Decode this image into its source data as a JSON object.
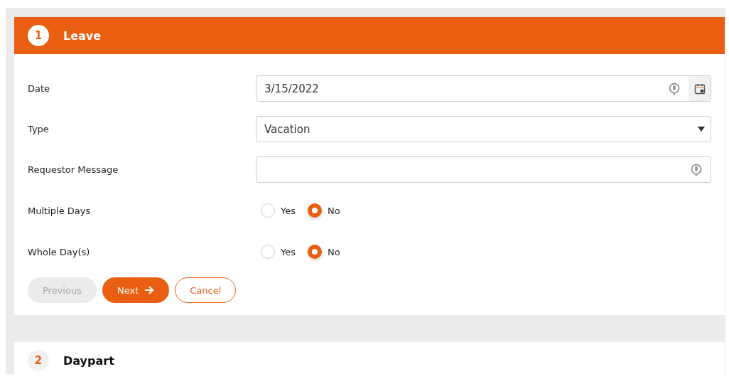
{
  "steps": [
    {
      "number": "1",
      "title": "Leave",
      "active": true,
      "fields": [
        {
          "kind": "date",
          "label": "Date",
          "value": "3/15/2022"
        },
        {
          "kind": "select",
          "label": "Type",
          "value": "Vacation"
        },
        {
          "kind": "text",
          "label": "Requestor Message"
        },
        {
          "kind": "radio",
          "label": "Multiple Days",
          "options": [
            {
              "label": "Yes",
              "selected": false
            },
            {
              "label": "No",
              "selected": true
            }
          ]
        },
        {
          "kind": "radio",
          "label": "Whole Day(s)",
          "options": [
            {
              "label": "Yes",
              "selected": false
            },
            {
              "label": "No",
              "selected": true
            }
          ]
        }
      ],
      "buttons": [
        {
          "kind": "plain",
          "label": "Previous",
          "disabled": true
        },
        {
          "kind": "next",
          "label": "Next",
          "disabled": false
        },
        {
          "kind": "outline",
          "label": "Cancel",
          "disabled": false
        }
      ]
    },
    {
      "number": "2",
      "title": "Daypart",
      "active": false
    }
  ]
}
